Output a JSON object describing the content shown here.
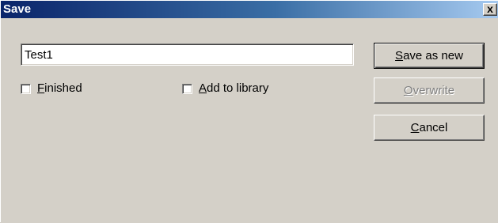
{
  "window": {
    "title": "Save",
    "close_glyph": "x"
  },
  "name_field": {
    "value": "Test1"
  },
  "options": {
    "finished": {
      "label_accel": "F",
      "label_rest": "inished",
      "checked": false
    },
    "add_to_library": {
      "label_accel": "A",
      "label_rest": "dd to library",
      "checked": false
    }
  },
  "buttons": {
    "save_as_new": {
      "accel": "S",
      "rest": "ave as new",
      "enabled": true
    },
    "overwrite": {
      "accel": "O",
      "rest": "verwrite",
      "enabled": false
    },
    "cancel": {
      "accel": "C",
      "rest": "ancel",
      "enabled": true
    }
  },
  "colors": {
    "titlebar_start": "#0a246a",
    "titlebar_end": "#a6caf0",
    "face": "#d4d0c8"
  }
}
